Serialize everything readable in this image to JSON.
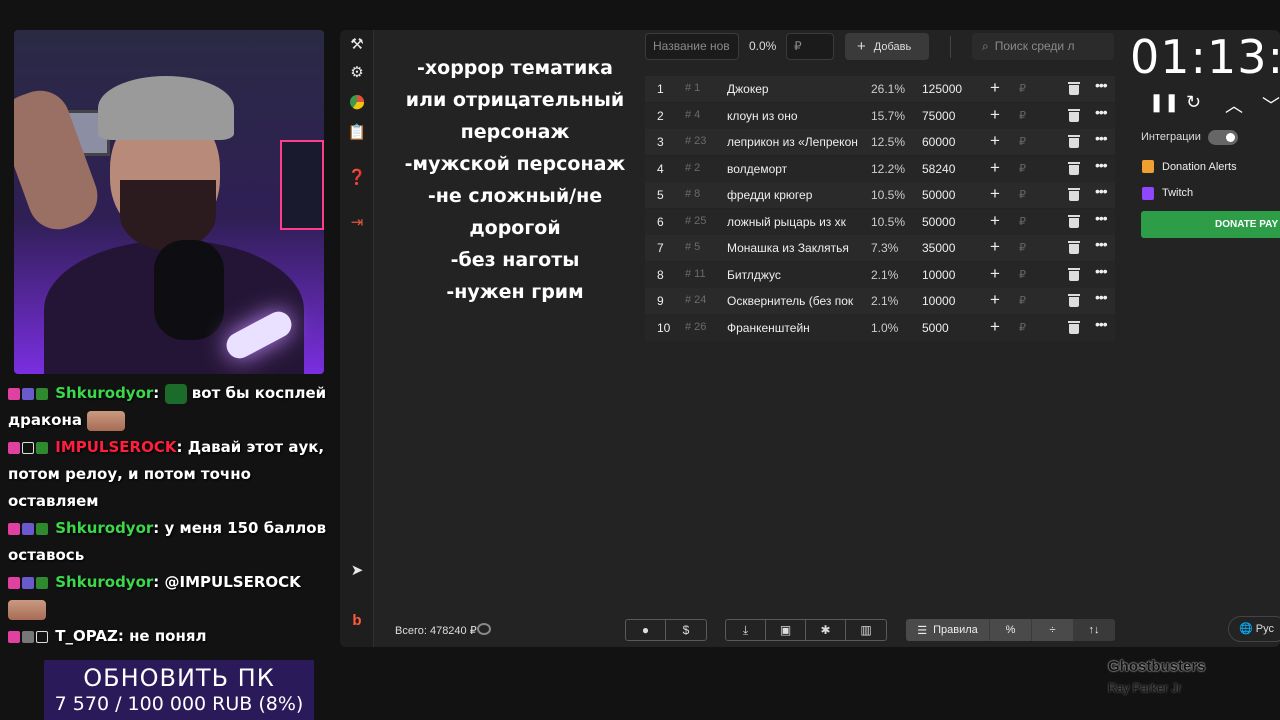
{
  "criteria": [
    "-хоррор тематика",
    "или отрицательный",
    "персонаж",
    "-мужской персонаж",
    "-не сложный/не",
    "дорогой",
    "-без наготы",
    "-нужен грим"
  ],
  "controls": {
    "name_placeholder": "Название нов",
    "percent": "0.0%",
    "amount_placeholder": "₽",
    "add_label": "Добавь",
    "search_placeholder": "Поиск среди л"
  },
  "lots": [
    {
      "num": "1",
      "id": "# 1",
      "name": "Джокер",
      "pct": "26.1%",
      "amount": "125000"
    },
    {
      "num": "2",
      "id": "# 4",
      "name": "клоун из оно",
      "pct": "15.7%",
      "amount": "75000"
    },
    {
      "num": "3",
      "id": "# 23",
      "name": "леприкон из «Лепрекон",
      "pct": "12.5%",
      "amount": "60000"
    },
    {
      "num": "4",
      "id": "# 2",
      "name": "волдеморт",
      "pct": "12.2%",
      "amount": "58240"
    },
    {
      "num": "5",
      "id": "# 8",
      "name": "фредди крюгер",
      "pct": "10.5%",
      "amount": "50000"
    },
    {
      "num": "6",
      "id": "# 25",
      "name": "ложный рыцарь из хк",
      "pct": "10.5%",
      "amount": "50000"
    },
    {
      "num": "7",
      "id": "# 5",
      "name": "Монашка из Заклятья",
      "pct": "7.3%",
      "amount": "35000"
    },
    {
      "num": "8",
      "id": "# 11",
      "name": "Битлджус",
      "pct": "2.1%",
      "amount": "10000"
    },
    {
      "num": "9",
      "id": "# 24",
      "name": "Осквернитель (без пок",
      "pct": "2.1%",
      "amount": "10000"
    },
    {
      "num": "10",
      "id": "# 26",
      "name": "Франкенштейн",
      "pct": "1.0%",
      "amount": "5000"
    }
  ],
  "row_labels": {
    "plus": "+",
    "rub": "₽",
    "more": "•••"
  },
  "footer": {
    "total": "Всего: 478240 ₽",
    "rules_label": "Правила",
    "percent_btn": "%",
    "sort_btn": "↑↓",
    "lang": "Рус"
  },
  "timer": {
    "time": "01:13:",
    "integrations_label": "Интеграции",
    "services": [
      "Donation Alerts",
      "Twitch"
    ],
    "donate_label": "DONATE PAY"
  },
  "chat": [
    {
      "user": "Shkurodyor",
      "text": "вот бы косплей дракона"
    },
    {
      "user": "IMPULSEROCK",
      "text": "Давай этот аук, потом релоу, и потом точно оставляем"
    },
    {
      "user": "Shkurodyor",
      "text": "у меня 150 баллов оставось"
    },
    {
      "user": "Shkurodyor",
      "text": "@IMPULSEROCK"
    },
    {
      "user": "T_OPAZ",
      "text": "не понял"
    }
  ],
  "goal": {
    "title": "ОБНОВИТЬ ПК",
    "progress_text": "7 570 / 100 000 RUB (8%)",
    "progress": 0.08
  },
  "now_playing": {
    "song": "Ghostbusters",
    "artist": "Ray Parker Jr"
  },
  "colors": {
    "accent_green": "#2e9d48",
    "chat_green": "#3cd84a",
    "chat_red": "#ff1f3c"
  }
}
